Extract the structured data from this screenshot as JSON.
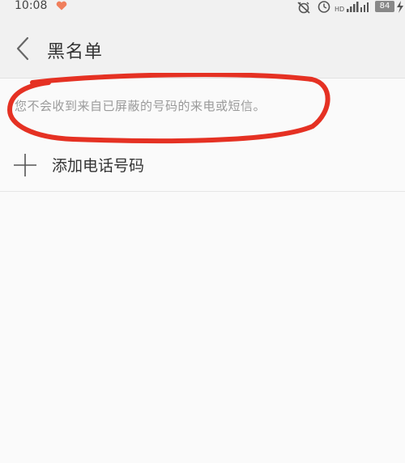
{
  "status_bar": {
    "time": "10:08",
    "battery": "84",
    "icons": [
      "heart-icon",
      "alarm-off-icon",
      "clock-icon",
      "hd-icon",
      "signal-icon",
      "battery-icon",
      "charging-icon"
    ]
  },
  "app_bar": {
    "title": "黑名单",
    "back_icon": "chevron-left-icon"
  },
  "notice": {
    "text": "您不会收到来自已屏蔽的号码的来电或短信。"
  },
  "add_number": {
    "label": "添加电话号码",
    "icon": "plus-icon"
  },
  "colors": {
    "annotation": "#e53123",
    "heart": "#f07f5c",
    "text_primary": "#333333",
    "text_secondary": "#9a9a9a",
    "bar_background": "#f1f1f1",
    "page_background": "#fafafa"
  }
}
